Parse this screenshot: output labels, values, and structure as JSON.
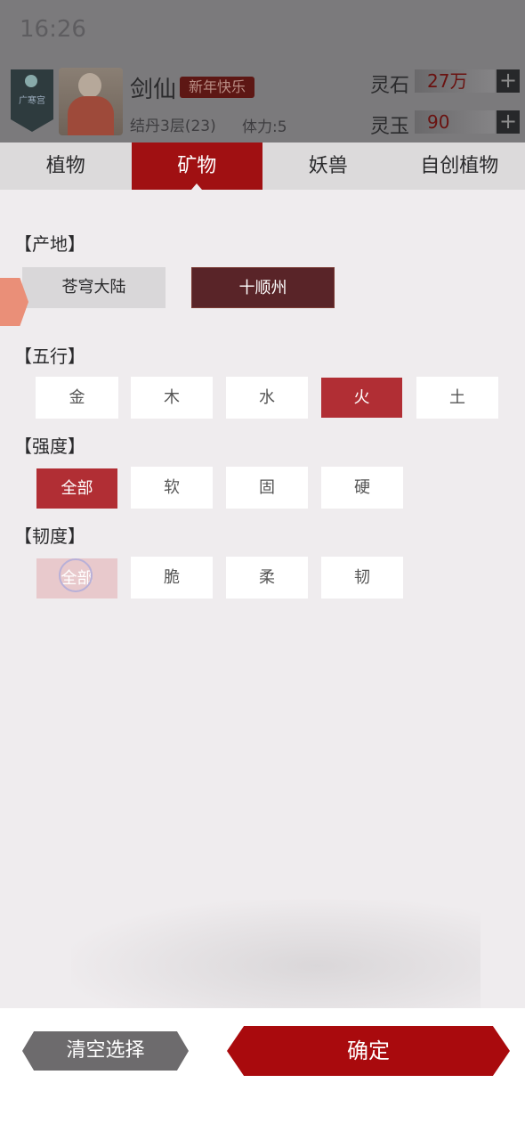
{
  "status": {
    "time": "16:26"
  },
  "player": {
    "emblem_text": "广寒宫",
    "name": "剑仙",
    "tag": "新年快乐",
    "realm": "结丹3层(23)",
    "stamina": "体力:5"
  },
  "resources": [
    {
      "label": "灵石",
      "value": "27万"
    },
    {
      "label": "灵玉",
      "value": "90"
    }
  ],
  "tabs": [
    "植物",
    "矿物",
    "妖兽",
    "自创植物"
  ],
  "active_tab": 1,
  "filters": {
    "origin": {
      "title": "【产地】",
      "options": [
        "苍穹大陆",
        "十顺州"
      ],
      "selected": "十顺州"
    },
    "elements": {
      "title": "【五行】",
      "options": [
        "金",
        "木",
        "水",
        "火",
        "土"
      ],
      "selected": "火"
    },
    "hardness": {
      "title": "【强度】",
      "options": [
        "全部",
        "软",
        "固",
        "硬"
      ],
      "selected": "全部"
    },
    "toughness": {
      "title": "【韧度】",
      "options": [
        "全部",
        "脆",
        "柔",
        "韧"
      ],
      "selected": "全部"
    }
  },
  "buttons": {
    "clear": "清空选择",
    "confirm": "确定"
  },
  "colors": {
    "accent": "#a01012",
    "selected_chip": "#b12e34",
    "origin_selected": "#592428"
  }
}
